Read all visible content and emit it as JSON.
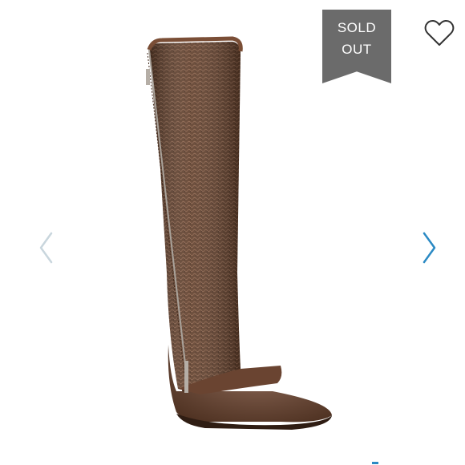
{
  "badge": {
    "line1": "SOLD",
    "line2": "OUT",
    "color": "#6b6b6b"
  },
  "icons": {
    "favorite": "heart-outline-icon",
    "previous": "chevron-left-icon",
    "next": "chevron-right-icon"
  },
  "colors": {
    "accent": "#2b8ac4",
    "arrow_disabled": "#c9d6dd",
    "boot_leather": "#6b4631"
  }
}
